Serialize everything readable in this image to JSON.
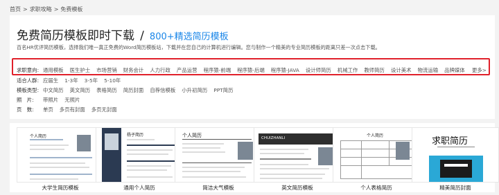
{
  "breadcrumb": [
    "首页",
    ">",
    "求职攻略",
    ">",
    "免费模板"
  ],
  "header": {
    "title": "免费简历模板即时下载",
    "separator": "/",
    "link": "800+精选简历模板",
    "description": "百名HR优评简历模板，选择我们唯一真正免费的Word简历模板站，下载并在您自己的计算机进行编辑。您与制作一个精美的专业简历模板的距离只差一次点击下载。"
  },
  "filters": {
    "intent": {
      "label": "求职意向:",
      "items": [
        "通用模板",
        "医生护士",
        "市场营销",
        "财务会计",
        "人力行政",
        "产品运营",
        "程序猿-前端",
        "程序猿-后端",
        "程序猿-JAVA",
        "设计师简历",
        "机械工作",
        "教师简历",
        "设计美术",
        "物流运输",
        "品牌媒体"
      ],
      "more": "更多>"
    },
    "people": {
      "label": "适合人群:",
      "items": [
        "应届生",
        "1-3年",
        "3-5年",
        "5-10年"
      ]
    },
    "type": {
      "label": "模板类型:",
      "items": [
        "中文简历",
        "英文简历",
        "表格简历",
        "简历封面",
        "自荐信模板",
        "小升初简历",
        "PPT简历"
      ]
    },
    "photo": {
      "label": "照　片:",
      "items": [
        "带照片",
        "无照片"
      ]
    },
    "pages": {
      "label": "页　数:",
      "items": [
        "单页",
        "多页有封面",
        "多页无封面"
      ]
    }
  },
  "cards": [
    {
      "title": "大学生简历模板",
      "head": "个人简历"
    },
    {
      "title": "通用个人简历",
      "head": "杨子简历"
    },
    {
      "title": "简洁大气模板",
      "head": "个人简历"
    },
    {
      "title": "英文简历模板",
      "head": "CHUIZHANLI"
    },
    {
      "title": "个人表格简历",
      "head": "个人简历"
    },
    {
      "title": "精美简历封面",
      "head": "求职简历"
    }
  ],
  "colors": {
    "accent": "#1a86e8",
    "highlight_border": "#e0202a",
    "banner_dark": "#2b3a52",
    "cover_blue": "#2aa8d6"
  }
}
